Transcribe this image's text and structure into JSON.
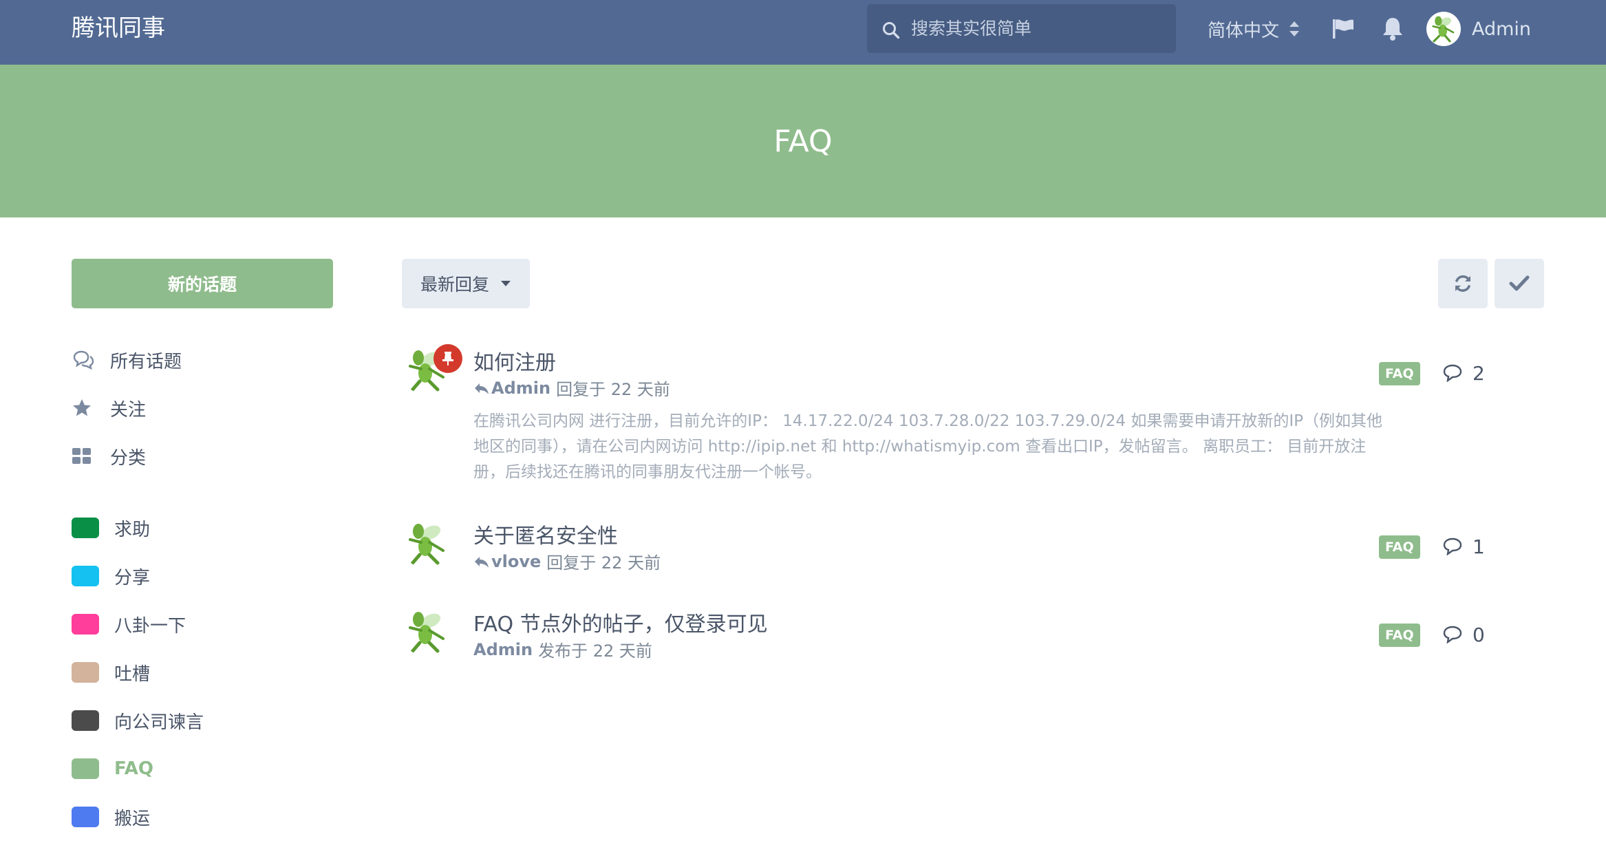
{
  "header": {
    "brand": "腾讯同事",
    "search_placeholder": "搜索其实很简单",
    "language": "简体中文",
    "username": "Admin"
  },
  "hero": {
    "title": "FAQ"
  },
  "sidebar": {
    "new_topic": "新的话题",
    "nav": [
      {
        "label": "所有话题",
        "icon": "comments-icon"
      },
      {
        "label": "关注",
        "icon": "star-icon"
      },
      {
        "label": "分类",
        "icon": "grid-icon"
      }
    ],
    "tags": [
      {
        "label": "求助",
        "color": "#0a8f47"
      },
      {
        "label": "分享",
        "color": "#14c1f0"
      },
      {
        "label": "八卦一下",
        "color": "#ff3d9a"
      },
      {
        "label": "吐槽",
        "color": "#d3b39b"
      },
      {
        "label": "向公司谏言",
        "color": "#4b4b4b"
      },
      {
        "label": "FAQ",
        "color": "#8fbc8c",
        "active": true
      },
      {
        "label": "搬运",
        "color": "#4e7bef"
      }
    ]
  },
  "toolbar": {
    "sort_label": "最新回复"
  },
  "topics": [
    {
      "title": "如何注册",
      "pinned": true,
      "author": "Admin",
      "action": "回复于 22 天前",
      "reply_icon": true,
      "excerpt": "在腾讯公司内网 进行注册，目前允许的IP： 14.17.22.0/24 103.7.28.0/22 103.7.29.0/24 如果需要申请开放新的IP（例如其他地区的同事），请在公司内网访问 http://ipip.net 和 http://whatismyip.com 查看出口IP，发帖留言。 离职员工： 目前开放注册，后续找还在腾讯的同事朋友代注册一个帐号。",
      "tag": "FAQ",
      "replies": "2"
    },
    {
      "title": "关于匿名安全性",
      "pinned": false,
      "author": "vlove",
      "action": "回复于 22 天前",
      "reply_icon": true,
      "excerpt": "",
      "tag": "FAQ",
      "replies": "1"
    },
    {
      "title": "FAQ 节点外的帖子，仅登录可见",
      "pinned": false,
      "author": "Admin",
      "action": "发布于 22 天前",
      "reply_icon": false,
      "excerpt": "",
      "tag": "FAQ",
      "replies": "0"
    }
  ],
  "colors": {
    "header_bg": "#526a93",
    "accent": "#8fbc8c",
    "pin": "#d33a2c"
  }
}
